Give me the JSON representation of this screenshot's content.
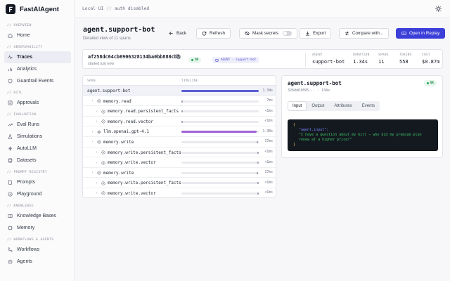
{
  "app": {
    "name": "FastAIAgent"
  },
  "topbar": {
    "mode": "Local UI",
    "separator": "//",
    "status": "auth disabled"
  },
  "sidebar": {
    "sections": [
      {
        "title": "// OVERVIEW",
        "items": [
          {
            "label": "Home",
            "icon": "home-icon"
          }
        ]
      },
      {
        "title": "// OBSERVABILITY",
        "items": [
          {
            "label": "Traces",
            "icon": "activity-icon",
            "active": true
          },
          {
            "label": "Analytics",
            "icon": "bar-chart-icon"
          },
          {
            "label": "Guardrail Events",
            "icon": "shield-icon"
          }
        ]
      },
      {
        "title": "// HITL",
        "items": [
          {
            "label": "Approvals",
            "icon": "check-square-icon"
          }
        ]
      },
      {
        "title": "// EVALUATION",
        "items": [
          {
            "label": "Eval Runs",
            "icon": "trend-icon"
          },
          {
            "label": "Simulations",
            "icon": "flask-icon"
          },
          {
            "label": "AutoLLM",
            "icon": "bolt-icon"
          },
          {
            "label": "Datasets",
            "icon": "database-icon"
          }
        ]
      },
      {
        "title": "// PROMPT REGISTRY",
        "items": [
          {
            "label": "Prompts",
            "icon": "file-icon"
          },
          {
            "label": "Playground",
            "icon": "play-icon"
          }
        ]
      },
      {
        "title": "// KNOWLEDGE",
        "items": [
          {
            "label": "Knowledge Bases",
            "icon": "book-icon"
          },
          {
            "label": "Memory",
            "icon": "memory-icon"
          }
        ]
      },
      {
        "title": "// WORKFLOWS & AGENTS",
        "items": [
          {
            "label": "Workflows",
            "icon": "workflow-icon"
          },
          {
            "label": "Agents",
            "icon": "bot-icon"
          }
        ]
      }
    ]
  },
  "header": {
    "title": "agent.support-bot",
    "subtitle": "Detailed view of 11 spans",
    "back_label": "Back",
    "refresh_label": "Refresh",
    "mask_label": "Mask secrets",
    "mask_on": false,
    "export_label": "Export",
    "compare_label": "Compare with...",
    "replay_label": "Open in Replay"
  },
  "trace": {
    "id": "af258dc64cb6906328134ba0bb880cb3",
    "started": "started just now",
    "status": "OK",
    "agent_tag": "AGENT · support-bot",
    "stats": [
      {
        "key": "AGENT",
        "value": "support-bot"
      },
      {
        "key": "DURATION",
        "value": "1.34s"
      },
      {
        "key": "SPANS",
        "value": "11"
      },
      {
        "key": "TOKENS",
        "value": "558"
      },
      {
        "key": "COST",
        "value": "$0.87m"
      }
    ]
  },
  "spans_table": {
    "headers": {
      "span": "SPAN",
      "timeline": "TIMELINE"
    },
    "rows": [
      {
        "name": "agent.support-bot",
        "depth": 0,
        "chevron": "",
        "icon": "",
        "duration": "1.34s",
        "start": 0,
        "width": 1.0,
        "color": "#5b5fd6",
        "selected": true
      },
      {
        "name": "memory.read",
        "depth": 1,
        "chevron": "›",
        "icon": "memory",
        "duration": "7ms",
        "start": 0.0,
        "width": 0.005,
        "color": "#9aa0ad"
      },
      {
        "name": "memory.read.persistent_facts",
        "depth": 2,
        "chevron": "›",
        "icon": "memory",
        "duration": "<1ms",
        "start": 0.0,
        "width": 0.002,
        "color": "#9aa0ad"
      },
      {
        "name": "memory.read.vector",
        "depth": 2,
        "chevron": "›",
        "icon": "memory",
        "duration": "<1ms",
        "start": 0.0,
        "width": 0.002,
        "color": "#9aa0ad"
      },
      {
        "name": "llm.openai.gpt-4.1",
        "depth": 1,
        "chevron": "›",
        "icon": "llm",
        "duration": "1.30s",
        "start": 0.0,
        "width": 0.97,
        "color": "#a25fd6"
      },
      {
        "name": "memory.write",
        "depth": 1,
        "chevron": "›",
        "icon": "memory",
        "duration": "17ms",
        "start": 0.975,
        "width": 0.013,
        "color": "#9aa0ad"
      },
      {
        "name": "memory.write.persistent_facts",
        "depth": 2,
        "chevron": "›",
        "icon": "memory",
        "duration": "<1ms",
        "start": 0.985,
        "width": 0.004,
        "color": "#9aa0ad"
      },
      {
        "name": "memory.write.vector",
        "depth": 2,
        "chevron": "›",
        "icon": "memory",
        "duration": "<1ms",
        "start": 0.985,
        "width": 0.004,
        "color": "#9aa0ad"
      },
      {
        "name": "memory.write",
        "depth": 1,
        "chevron": "›",
        "icon": "memory",
        "duration": "17ms",
        "start": 0.975,
        "width": 0.013,
        "color": "#9aa0ad"
      },
      {
        "name": "memory.write.persistent_facts",
        "depth": 2,
        "chevron": "›",
        "icon": "memory",
        "duration": "<1ms",
        "start": 0.985,
        "width": 0.004,
        "color": "#9aa0ad"
      },
      {
        "name": "memory.write.vector",
        "depth": 2,
        "chevron": "›",
        "icon": "memory",
        "duration": "<1ms",
        "start": 0.985,
        "width": 0.004,
        "color": "#9aa0ad"
      }
    ]
  },
  "detail": {
    "title": "agent.support-bot",
    "sub": "326dd63895... · 134s",
    "status": "OK",
    "tabs": [
      "Input",
      "Output",
      "Attributes",
      "Events"
    ],
    "active_tab": "Input",
    "code": {
      "open": "{",
      "key": "\"agent.input\":",
      "value": "\"I have a question about my bill — why did my premium plan renew at a higher price?\"",
      "close": "}"
    }
  },
  "colors": {
    "accent": "#3b3fd8",
    "ok": "#22a35a",
    "llm_bar": "#a25fd6",
    "root_bar": "#5b5fd6"
  }
}
